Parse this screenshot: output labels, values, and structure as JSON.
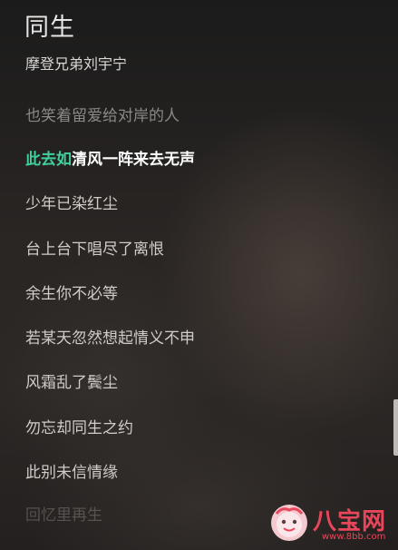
{
  "header": {
    "song_title": "同生",
    "artist": "摩登兄弟刘宇宁"
  },
  "lyrics": {
    "previous_line": "也笑着留爱给对岸的人",
    "current_line_played": "此去如",
    "current_line_unplayed": "清风一阵来去无声",
    "upcoming": [
      "少年已染红尘",
      "台上台下唱尽了离恨",
      "余生你不必等",
      "若某天忽然想起情义不申",
      "风霜乱了鬓尘",
      "勿忘却同生之约",
      "此别未信情缘",
      "回忆里再生"
    ]
  },
  "watermark": {
    "brand": "八宝网",
    "url": "www.8bb.com"
  },
  "colors": {
    "highlight": "#3fcf9a",
    "watermark": "#e8475b"
  }
}
